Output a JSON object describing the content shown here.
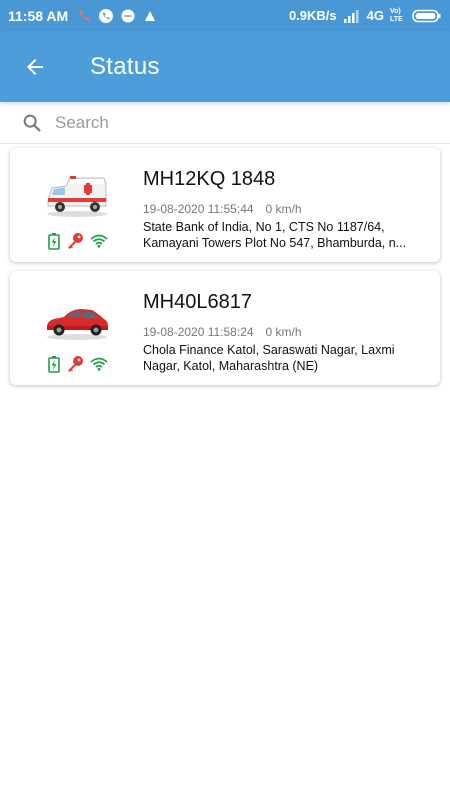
{
  "status_bar": {
    "time": "11:58 AM",
    "network_speed": "0.9KB/s",
    "network_type": "4G",
    "volte_label": "Vo) LTE"
  },
  "app_bar": {
    "title": "Status",
    "back_icon": "arrow-left-icon"
  },
  "search": {
    "placeholder": "Search",
    "value": ""
  },
  "vehicles": [
    {
      "plate": "MH12KQ 1848",
      "datetime": "19-08-2020 11:55:44",
      "speed": "0 km/h",
      "address": "State Bank of India, No 1, CTS No 1187/64, Kamayani Towers Plot No 547, Bhamburda, n...",
      "vehicle_icon": "ambulance-icon",
      "status_icons": [
        "battery-charging-icon",
        "ignition-key-icon",
        "wifi-icon"
      ]
    },
    {
      "plate": "MH40L6817",
      "datetime": "19-08-2020 11:58:24",
      "speed": "0 km/h",
      "address": "Chola Finance Katol, Saraswati Nagar, Laxmi Nagar, Katol, Maharashtra (NE)",
      "vehicle_icon": "car-icon",
      "status_icons": [
        "battery-charging-icon",
        "ignition-key-icon",
        "wifi-icon"
      ]
    }
  ],
  "colors": {
    "app_bar": "#4e9ddb",
    "status_bar": "#4a97d6",
    "battery": "#1e9e4a",
    "key": "#e53935",
    "wifi": "#1e9e4a"
  }
}
